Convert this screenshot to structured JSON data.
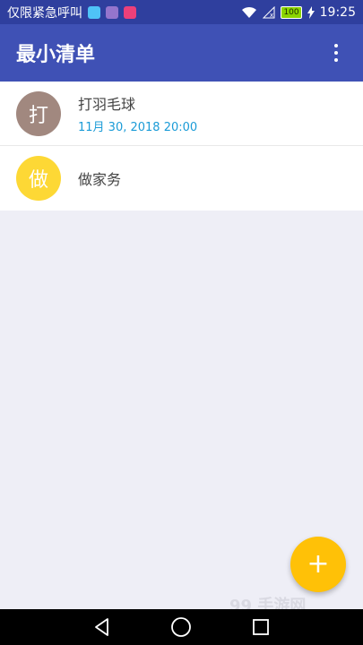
{
  "status_bar": {
    "carrier_text": "仅限紧急呼叫",
    "battery": "100",
    "time": "19:25"
  },
  "app_bar": {
    "title": "最小清单"
  },
  "todos": [
    {
      "avatar_char": "打",
      "avatar_color": "#a1887f",
      "title": "打羽毛球",
      "date": "11月 30, 2018  20:00"
    },
    {
      "avatar_char": "做",
      "avatar_color": "#fdd835",
      "title": "做家务",
      "date": ""
    }
  ],
  "fab": {
    "label": "+"
  },
  "watermark": "99  手游网",
  "colors": {
    "primary": "#3f51b5",
    "status_bar": "#2f3f9e",
    "accent": "#ffc107",
    "date_text": "#1a9bd7"
  }
}
